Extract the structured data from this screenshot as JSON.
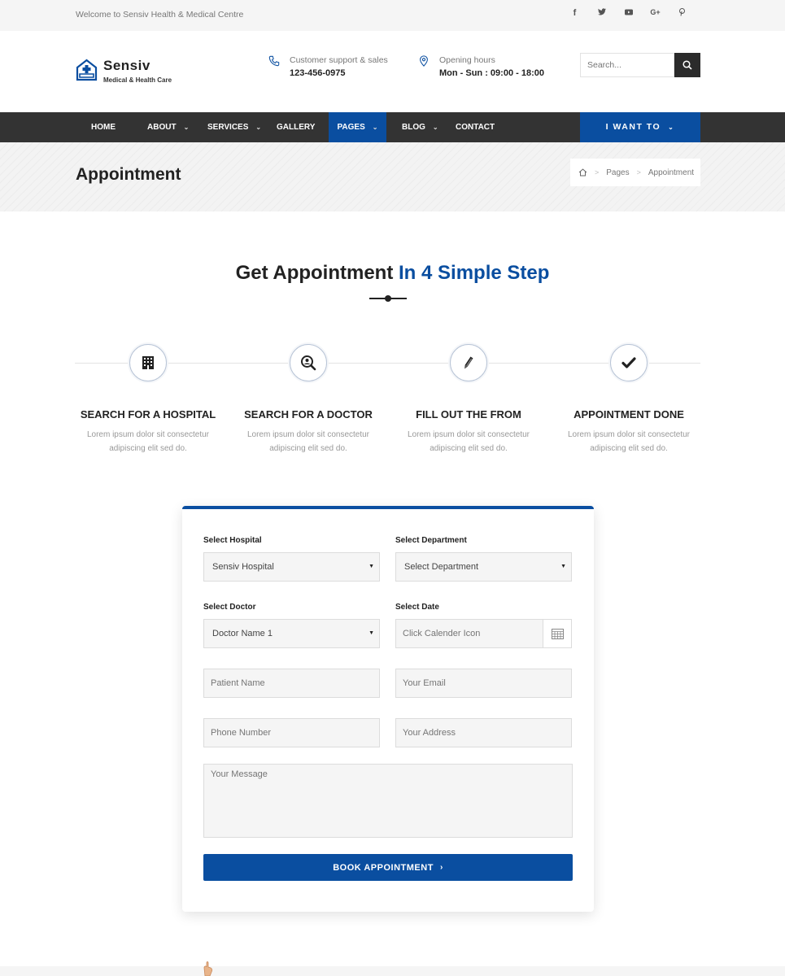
{
  "topbar": {
    "welcome": "Welcome to Sensiv Health & Medical Centre",
    "socials": [
      "f",
      "t",
      "▶",
      "G+",
      "p"
    ]
  },
  "brand": {
    "name": "Sensiv",
    "tagline": "Medical & Health Care",
    "accent_color": "#0a4ea0"
  },
  "contact": {
    "support_label": "Customer support & sales",
    "support_value": "123-456-0975",
    "hours_label": "Opening hours",
    "hours_value": "Mon - Sun : 09:00 - 18:00"
  },
  "search": {
    "placeholder": "Search..."
  },
  "nav": {
    "items": [
      {
        "label": "HOME"
      },
      {
        "label": "ABOUT"
      },
      {
        "label": "SERVICES"
      },
      {
        "label": "GALLERY"
      },
      {
        "label": "PAGES"
      },
      {
        "label": "BLOG"
      },
      {
        "label": "CONTACT"
      }
    ],
    "active": "PAGES",
    "cta": "I WANT TO"
  },
  "page": {
    "title": "Appointment",
    "breadcrumb": [
      "Pages",
      "Appointment"
    ]
  },
  "section": {
    "title_main": "Get Appointment",
    "title_highlight": "In 4 Simple Step"
  },
  "steps": [
    {
      "icon": "hospital-icon",
      "title": "SEARCH FOR A HOSPITAL",
      "desc1": "Lorem ipsum dolor sit consectetur",
      "desc2": "adipiscing elit sed do."
    },
    {
      "icon": "doctor-search-icon",
      "title": "SEARCH FOR A DOCTOR",
      "desc1": "Lorem ipsum dolor sit consectetur",
      "desc2": "adipiscing elit sed do."
    },
    {
      "icon": "pencil-icon",
      "title": "FILL OUT THE FROM",
      "desc1": "Lorem ipsum dolor sit consectetur",
      "desc2": "adipiscing elit sed do."
    },
    {
      "icon": "check-icon",
      "title": "APPOINTMENT DONE",
      "desc1": "Lorem ipsum dolor sit consectetur",
      "desc2": "adipiscing elit sed do."
    }
  ],
  "form": {
    "hospital_label": "Select Hospital",
    "hospital_value": "Sensiv Hospital",
    "department_label": "Select Department",
    "department_value": "Select Department",
    "doctor_label": "Select Doctor",
    "doctor_value": "Doctor Name 1",
    "date_label": "Select Date",
    "date_placeholder": "Click Calender Icon",
    "patient_placeholder": "Patient Name",
    "email_placeholder": "Your Email",
    "phone_placeholder": "Phone Number",
    "address_placeholder": "Your Address",
    "message_placeholder": "Your Message",
    "submit_label": "BOOK APPOINTMENT"
  }
}
